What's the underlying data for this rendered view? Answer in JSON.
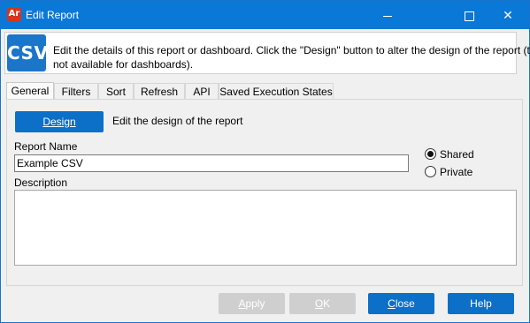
{
  "window": {
    "title": "Edit Report",
    "app_icon_text": "Ar"
  },
  "info": {
    "icon_text": "CSV",
    "line1": "Edit the details of this report or dashboard.  Click the \"Design\" button to alter the design of the report (this is",
    "line2": "not available for dashboards)."
  },
  "tabs": [
    {
      "label": "General",
      "active": true
    },
    {
      "label": "Filters"
    },
    {
      "label": "Sort"
    },
    {
      "label": "Refresh"
    },
    {
      "label": "API"
    },
    {
      "label": "Saved Execution States"
    }
  ],
  "general": {
    "design_button": "Design",
    "design_description": "Edit the design of the report",
    "report_name_label": "Report Name",
    "report_name_value": "Example CSV",
    "visibility": {
      "shared_label": "Shared",
      "private_label": "Private",
      "selected": "Shared"
    },
    "description_label": "Description",
    "description_value": ""
  },
  "footer": {
    "apply": "Apply",
    "ok": "OK",
    "close": "Close",
    "help": "Help"
  },
  "colors": {
    "titlebar": "#0a78d7",
    "accent": "#0c6fc8"
  }
}
